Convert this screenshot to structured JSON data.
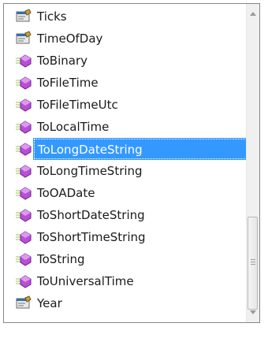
{
  "items": [
    {
      "label": "Ticks",
      "icon": "property-icon"
    },
    {
      "label": "TimeOfDay",
      "icon": "property-icon"
    },
    {
      "label": "ToBinary",
      "icon": "method-icon"
    },
    {
      "label": "ToFileTime",
      "icon": "method-icon"
    },
    {
      "label": "ToFileTimeUtc",
      "icon": "method-icon"
    },
    {
      "label": "ToLocalTime",
      "icon": "method-icon"
    },
    {
      "label": "ToLongDateString",
      "icon": "method-icon",
      "selected": true
    },
    {
      "label": "ToLongTimeString",
      "icon": "method-icon"
    },
    {
      "label": "ToOADate",
      "icon": "method-icon"
    },
    {
      "label": "ToShortDateString",
      "icon": "method-icon"
    },
    {
      "label": "ToShortTimeString",
      "icon": "method-icon"
    },
    {
      "label": "ToString",
      "icon": "method-icon"
    },
    {
      "label": "ToUniversalTime",
      "icon": "method-icon"
    },
    {
      "label": "Year",
      "icon": "property-icon"
    }
  ],
  "colors": {
    "selection": "#3399ff",
    "method": "#b84fd6",
    "property": "#c8c8c8"
  }
}
